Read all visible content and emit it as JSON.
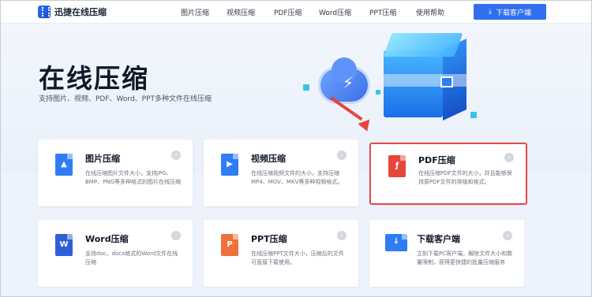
{
  "header": {
    "logo_text": "迅捷在线压缩",
    "nav": [
      "图片压缩",
      "视频压缩",
      "PDF压缩",
      "Word压缩",
      "PPT压缩",
      "使用帮助"
    ],
    "download_label": "下载客户端"
  },
  "hero": {
    "title": "在线压缩",
    "subtitle": "支持图片、视频、PDF、Word、PPT多种文件在线压缩"
  },
  "cards": [
    {
      "title": "图片压缩",
      "desc": "在线压缩图片文件大小，支持JPG、BMP、PNG等多种格式的图片在线压缩",
      "icon": "image-file-icon",
      "color": "#2f7df6"
    },
    {
      "title": "视频压缩",
      "desc": "在线压缩视频文件的大小，支持压缩MP4、MOV、MKV等多种视频格式。",
      "icon": "video-file-icon",
      "color": "#2f7df6"
    },
    {
      "title": "PDF压缩",
      "desc": "在线压缩PDF文件的大小，并且能够保持原PDF文件的排版和格式。",
      "icon": "pdf-file-icon",
      "color": "#e8453c"
    },
    {
      "title": "Word压缩",
      "desc": "支持doc、docx格式的Word文件在线压缩",
      "icon": "word-file-icon",
      "color": "#2f5fd8"
    },
    {
      "title": "PPT压缩",
      "desc": "在线压缩PPT文件大小，压缩后的文件可直接下载使用。",
      "icon": "ppt-file-icon",
      "color": "#f0703c"
    },
    {
      "title": "下载客户端",
      "desc": "立刻下载PC客户端，解除文件大小和数量限制，获得更快捷的批量压缩服务",
      "icon": "monitor-download-icon",
      "color": "#2f7df6"
    }
  ]
}
